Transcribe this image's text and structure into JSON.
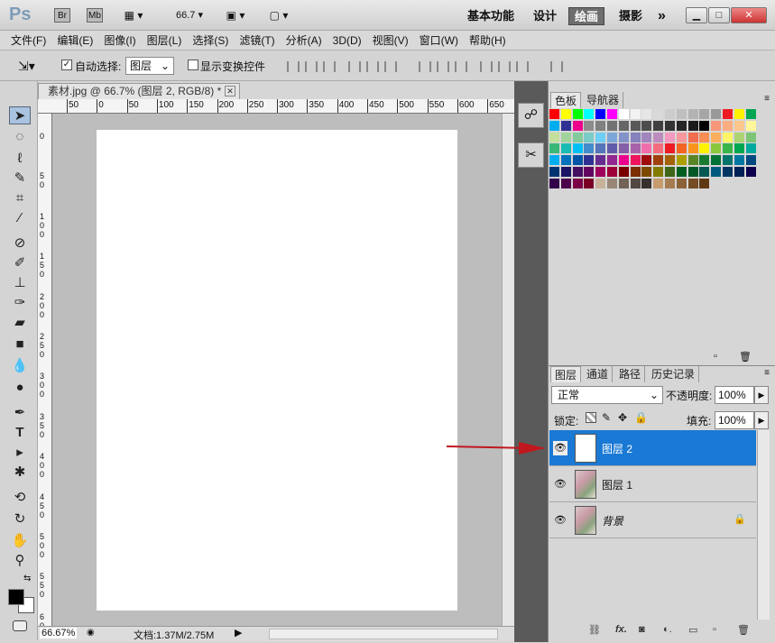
{
  "app": {
    "logo": "Ps",
    "launch_bridge": "Br",
    "launch_minibridge": "Mb",
    "zoom_value": "66.7",
    "workspaces": [
      "基本功能",
      "设计",
      "绘画",
      "摄影"
    ],
    "more_workspaces": "»",
    "active_workspace": "绘画"
  },
  "menu": [
    "文件(F)",
    "编辑(E)",
    "图像(I)",
    "图层(L)",
    "选择(S)",
    "滤镜(T)",
    "分析(A)",
    "3D(D)",
    "视图(V)",
    "窗口(W)",
    "帮助(H)"
  ],
  "options": {
    "auto_select_label": "自动选择:",
    "auto_select_checked": true,
    "auto_select_value": "图层",
    "show_transform_label": "显示变换控件",
    "show_transform_checked": false
  },
  "document": {
    "tab_title": "素材.jpg @ 66.7% (图层 2, RGB/8) *",
    "ruler_h": [
      "50",
      "0",
      "50",
      "100",
      "150",
      "200",
      "250",
      "300",
      "350",
      "400",
      "450",
      "500",
      "550",
      "600",
      "650"
    ],
    "ruler_v": [
      "0",
      "5\n0",
      "1\n0\n0",
      "1\n5\n0",
      "2\n0\n0",
      "2\n5\n0",
      "3\n0\n0",
      "3\n5\n0",
      "4\n0\n0",
      "4\n5\n0",
      "5\n0\n0",
      "5\n5\n0",
      "6\n0\n0"
    ],
    "zoom": "66.67%",
    "doc_info": "文档:1.37M/2.75M"
  },
  "swatches_panel": {
    "tabs": [
      "色板",
      "导航器"
    ],
    "colors": [
      "#ff0000",
      "#ffff00",
      "#00ff00",
      "#00ffff",
      "#0000ff",
      "#ff00ff",
      "#ffffff",
      "#f2f2f2",
      "#e6e6e6",
      "#d9d9d9",
      "#cccccc",
      "#bfbfbf",
      "#b3b3b3",
      "#a6a6a6",
      "#999999",
      "#ed1c24",
      "#fff200",
      "#00a651",
      "#00aeef",
      "#2e3192",
      "#ec008c",
      "#8c8c8c",
      "#808080",
      "#737373",
      "#666666",
      "#595959",
      "#4d4d4d",
      "#404040",
      "#333333",
      "#262626",
      "#1a1a1a",
      "#000000",
      "#f7977a",
      "#fbad82",
      "#fdc68c",
      "#fff799",
      "#c4df9b",
      "#a3d39c",
      "#82ca9c",
      "#7accc8",
      "#6dcff6",
      "#7da7d9",
      "#8393ca",
      "#8781bd",
      "#a186be",
      "#bd8cbf",
      "#f49ac1",
      "#f6989d",
      "#f26c4f",
      "#f68e56",
      "#fbaf5c",
      "#fff467",
      "#acd372",
      "#7cc576",
      "#3bb878",
      "#1abbb4",
      "#00bff3",
      "#438ccb",
      "#5574b9",
      "#605ca9",
      "#855fa8",
      "#a763a9",
      "#f06ea9",
      "#f26d7d",
      "#ed1c24",
      "#f26522",
      "#f7941d",
      "#fff200",
      "#8dc63f",
      "#39b54a",
      "#00a651",
      "#00a99d",
      "#00aeef",
      "#0072bc",
      "#0054a6",
      "#2e3192",
      "#662d91",
      "#92278f",
      "#ec008c",
      "#ed145b",
      "#9e0b0f",
      "#a0410d",
      "#a3620a",
      "#aba000",
      "#598527",
      "#197b30",
      "#007236",
      "#00746b",
      "#0076a3",
      "#004a80",
      "#003471",
      "#1b1464",
      "#440e62",
      "#630460",
      "#9e005d",
      "#9e0039",
      "#790000",
      "#7b2e00",
      "#7d4900",
      "#827b00",
      "#406618",
      "#005e20",
      "#005826",
      "#005952",
      "#005b7f",
      "#003663",
      "#002157",
      "#0d004c",
      "#32004b",
      "#4b0049",
      "#7b0046",
      "#7a0026",
      "#c7b299",
      "#998675",
      "#736357",
      "#534741",
      "#37302d",
      "#c69c6d",
      "#a67c52",
      "#8c6239",
      "#754c24",
      "#603913"
    ]
  },
  "layers_panel": {
    "tabs": [
      "图层",
      "通道",
      "路径",
      "历史记录"
    ],
    "blend_mode": "正常",
    "opacity_label": "不透明度:",
    "opacity": "100%",
    "lock_label": "锁定:",
    "fill_label": "填充:",
    "fill": "100%",
    "layers": [
      {
        "name": "图层 2",
        "selected": true,
        "visible": true,
        "locked": false,
        "thumb": "white"
      },
      {
        "name": "图层 1",
        "selected": false,
        "visible": true,
        "locked": false,
        "thumb": "photo"
      },
      {
        "name": "背景",
        "selected": false,
        "visible": true,
        "locked": true,
        "thumb": "photo"
      }
    ]
  }
}
